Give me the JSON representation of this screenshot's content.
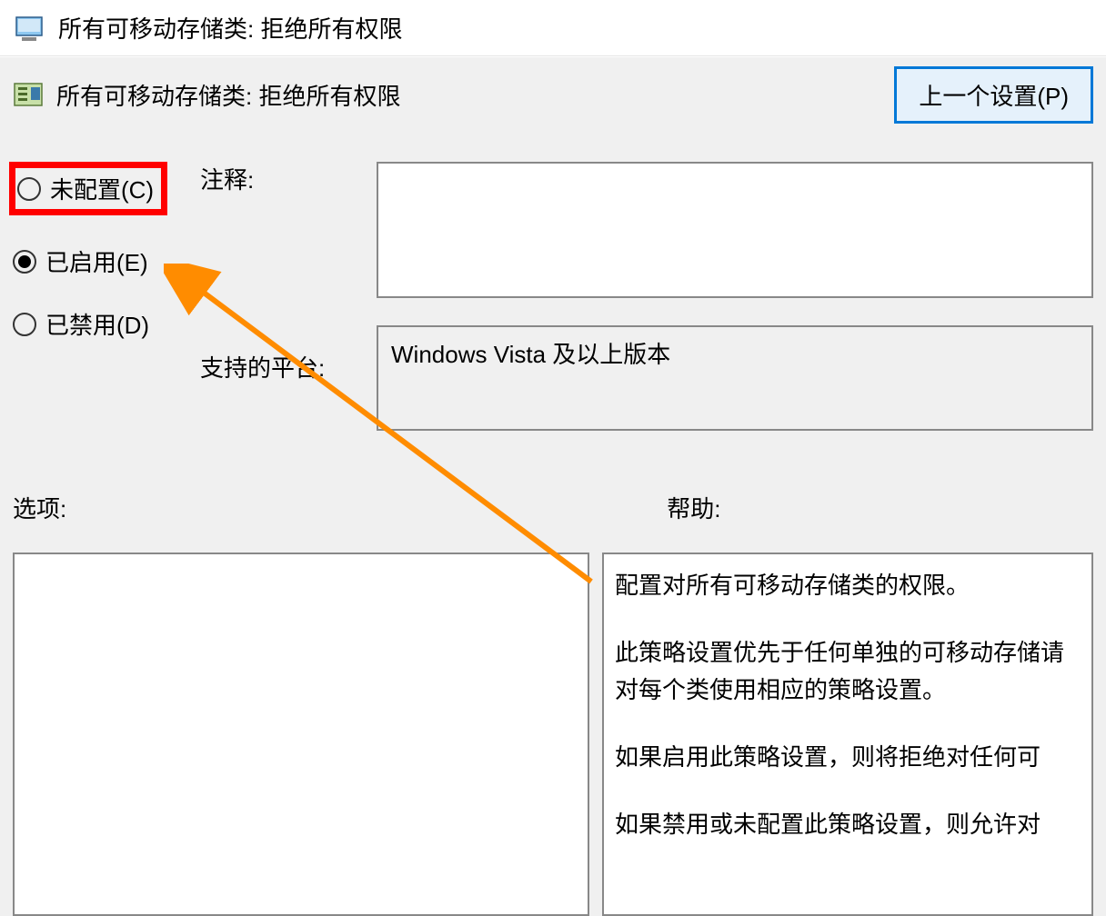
{
  "window": {
    "title": "所有可移动存储类: 拒绝所有权限"
  },
  "tab": {
    "title": "所有可移动存储类: 拒绝所有权限",
    "prev_button": "上一个设置(P)"
  },
  "radios": {
    "not_configured": "未配置(C)",
    "enabled": "已启用(E)",
    "disabled": "已禁用(D)"
  },
  "labels": {
    "note": "注释:",
    "platform": "支持的平台:",
    "options": "选项:",
    "help": "帮助:"
  },
  "fields": {
    "note_value": "",
    "platform_value": "Windows Vista 及以上版本"
  },
  "help_text": {
    "p1": "配置对所有可移动存储类的权限。",
    "p2": "此策略设置优先于任何单独的可移动存储请对每个类使用相应的策略设置。",
    "p3": "如果启用此策略设置，则将拒绝对任何可",
    "p4": "如果禁用或未配置此策略设置，则允许对"
  }
}
